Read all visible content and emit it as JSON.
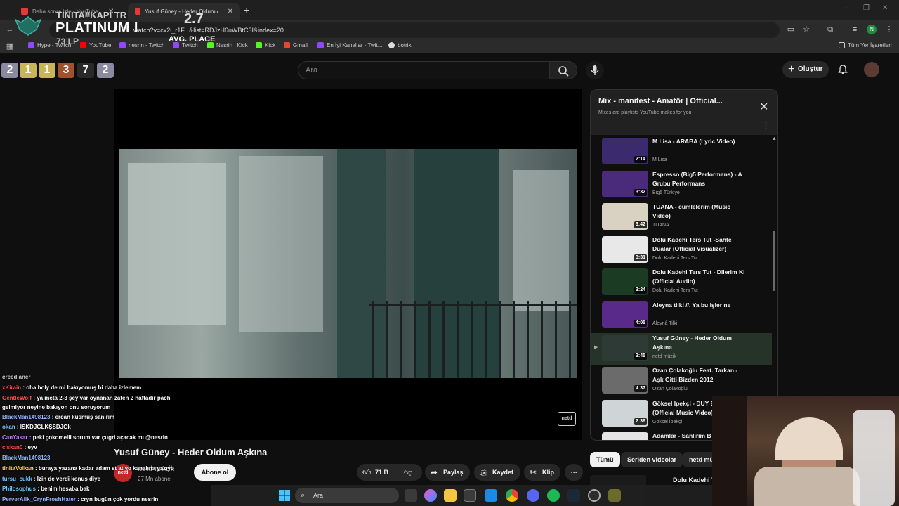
{
  "browser": {
    "tabs": [
      {
        "label": "Daha sonra izle - YouTube"
      },
      {
        "label": "Yusuf Güney - Heder Oldum Aşkına"
      }
    ],
    "new_tab": "+",
    "url": "watch?v=cx2i_r1F...&list=RDJzH6uWBtC3I&index=20",
    "profile_initial": "N",
    "bookmarks": [
      {
        "label": "Hype - Twitch",
        "color": "#9146ff"
      },
      {
        "label": "YouTube",
        "color": "#ff0000"
      },
      {
        "label": "nesrin - Twitch",
        "color": "#9146ff"
      },
      {
        "label": "Twitch",
        "color": "#9146ff"
      },
      {
        "label": "Nesrin | Kick",
        "color": "#53fc18"
      },
      {
        "label": "Kick",
        "color": "#53fc18"
      },
      {
        "label": "Gmail",
        "color": "#ea4335"
      },
      {
        "label": "En İyi Kanallar - Twit...",
        "color": "#9146ff"
      },
      {
        "label": "botrix",
        "color": "#dddddd"
      }
    ],
    "all_bookmarks": "Tüm Yer İşaretleri"
  },
  "overlay": {
    "title": "TINITA#KAPI TR",
    "rank": "PLATINUM I",
    "lp": "73 LP",
    "avg_value": "2.7",
    "avg_label": "AVG. PLACE",
    "placements": [
      {
        "value": "2",
        "color": "#8a8aa0"
      },
      {
        "value": "1",
        "color": "#c9b458"
      },
      {
        "value": "1",
        "color": "#c9b458"
      },
      {
        "value": "3",
        "color": "#a0522d"
      },
      {
        "value": "7",
        "color": "#2a2a2a"
      },
      {
        "value": "2",
        "color": "#8a8aa0"
      }
    ]
  },
  "youtube": {
    "search_placeholder": "Ara",
    "create_label": "Oluştur",
    "video_title": "Yusuf Güney - Heder Oldum Aşkına",
    "channel": {
      "name": "netd müzik",
      "subs": "27 Mn abone",
      "avatar_text": "netd"
    },
    "subscribe_label": "Abone ol",
    "likes": "71 B",
    "share_label": "Paylaş",
    "save_label": "Kaydet",
    "clip_label": "Klip",
    "watermark": "netd"
  },
  "playlist": {
    "title": "Mix - manifest - Amatör | Official...",
    "subtitle": "Mixes are playlists YouTube makes for you",
    "items": [
      {
        "title": "M Lisa - ARABA (Lyric Video)",
        "channel": "M Lisa",
        "duration": "2:14",
        "thumb": "#3b2a6e"
      },
      {
        "title": "Espresso (Big5 Performans) - A Grubu Performans",
        "channel": "Big5 Türkiye",
        "duration": "3:32",
        "thumb": "#4a2a7a"
      },
      {
        "title": "TUANA - cümlelerim (Music Video)",
        "channel": "TUANA",
        "duration": "3:42",
        "thumb": "#d9d2c3"
      },
      {
        "title": "Dolu Kadehi Ters Tut -Sahte Dualar (Official Visualizer)",
        "channel": "Dolu Kadehi Ters Tut",
        "duration": "3:31",
        "thumb": "#e8e8e8"
      },
      {
        "title": "Dolu Kadehi Ters Tut - Dilerim Ki (Official Audio)",
        "channel": "Dolu Kadehi Ters Tut",
        "duration": "3:24",
        "thumb": "#1b3b22"
      },
      {
        "title": "Aleyna tilki //. Ya bu işler ne",
        "channel": "Aleynâ Tilki",
        "duration": "4:05",
        "thumb": "#5a2a8a"
      },
      {
        "title": "Yusuf Güney - Heder Oldum Aşkına",
        "channel": "netd müzik",
        "duration": "3:45",
        "thumb": "#2e3a36"
      },
      {
        "title": "Ozan Çolakoğlu Feat. Tarkan - Aşk Gitti Bizden 2012",
        "channel": "Ozan Çolakoğlu",
        "duration": "4:37",
        "thumb": "#6b6b6b"
      },
      {
        "title": "Göksel İpekçi - DUY BENİ (Official Music Video)",
        "channel": "Göksel İpekçi",
        "duration": "2:36",
        "thumb": "#cfd4d6"
      },
      {
        "title": "Adamlar - Sanlırım B",
        "channel": "Adamlar",
        "duration": "",
        "thumb": "#e5e5e5"
      }
    ],
    "current_indicator": "▶"
  },
  "chips": {
    "all": "Tümü",
    "series": "Seriden videolar",
    "channel": "netd mü"
  },
  "next_video": "Dolu Kadehi T",
  "chat": [
    {
      "user": "creedlaner",
      "msg": "",
      "color": "#cccccc"
    },
    {
      "user": "xKirain",
      "msg": "oha holy de mi bakıyomuş bi daha izlemem",
      "color": "#ff4a4a"
    },
    {
      "user": "GentleWolf",
      "msg": "ya meta 2-3 şey var oynanan zaten 2 haftadır pach",
      "color": "#ff4a4a"
    },
    {
      "user": "",
      "msg": "gelmiyor neyine bakıyon onu soruyorum",
      "color": "#ffffff"
    },
    {
      "user": "BlackMan1498123",
      "msg": "ercan küsmüş sanırım",
      "color": "#8fb3ff"
    },
    {
      "user": "okan",
      "msg": "İSKDJGLKŞSDJGk",
      "color": "#6ec6ff"
    },
    {
      "user": "CanYasar",
      "msg": "peki çokomelli sorum var çugri açacak mı @nesrin",
      "color": "#c77dff"
    },
    {
      "user": "ciskan0",
      "msg": "eyv",
      "color": "#ff4a4a"
    },
    {
      "user": "BlackMan1498123",
      "msg": "",
      "color": "#8fb3ff"
    },
    {
      "user": "tinitaVolkan",
      "msg": "buraya yazana kadar adam st atıyo kanalına yazıyo",
      "color": "#ffd54a"
    },
    {
      "user": "tursu_cukk",
      "msg": "İzin de verdi konuş diye",
      "color": "#6ec6ff"
    },
    {
      "user": "Philosophus",
      "msg": "benim hesaba bak",
      "color": "#6ec6ff"
    },
    {
      "user": "PerverAlik_CrynFroshHater",
      "msg": "cryn bugün çok yordu nesrin",
      "color": "#8fb3ff"
    }
  ],
  "taskbar": {
    "search_placeholder": "Ara"
  },
  "colors": {
    "yt_bg": "#0f0f0f",
    "chrome_bg": "#2b2b2b",
    "current_row": "#263328"
  }
}
